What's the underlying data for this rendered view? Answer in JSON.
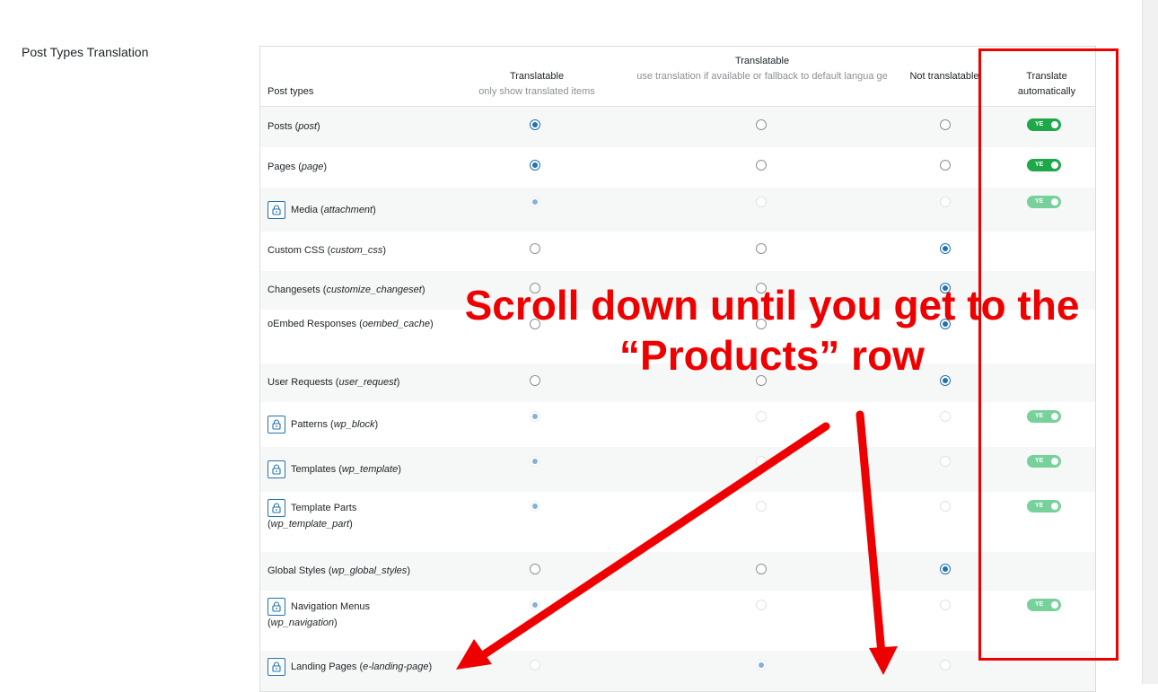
{
  "section": {
    "title": "Post Types Translation"
  },
  "header": {
    "post_types": "Post types",
    "translatable": {
      "title": "Translatable",
      "sub": "only show translated items"
    },
    "fallback": {
      "title": "Translatable",
      "sub": "use translation if available or fallback to default langua ge"
    },
    "not_translatable": "Not translatable",
    "auto": "Translate automatically"
  },
  "rows": [
    {
      "label": "Posts (",
      "slug": "post",
      "end": ")",
      "locked": false,
      "selected": "translatable",
      "auto": "YE"
    },
    {
      "label": "Pages (",
      "slug": "page",
      "end": ")",
      "locked": false,
      "selected": "translatable",
      "auto": "YE"
    },
    {
      "label": "Media (",
      "slug": "attachment",
      "end": ")",
      "locked": true,
      "selected": "translatable",
      "auto": "YE"
    },
    {
      "label": "Custom CSS (",
      "slug": "custom_css",
      "end": ")",
      "locked": false,
      "selected": "not_translatable",
      "auto": ""
    },
    {
      "label": "Changesets (",
      "slug": "customize_changeset",
      "end": ")",
      "locked": false,
      "selected": "not_translatable",
      "auto": ""
    },
    {
      "label": "oEmbed Responses (",
      "slug": "oembed_cache",
      "end": ")",
      "locked": false,
      "selected": "not_translatable",
      "auto": ""
    },
    {
      "label": "User Requests (",
      "slug": "user_request",
      "end": ")",
      "locked": false,
      "selected": "not_translatable",
      "auto": ""
    },
    {
      "label": "Patterns (",
      "slug": "wp_block",
      "end": ")",
      "locked": true,
      "selected": "translatable",
      "auto": "YE"
    },
    {
      "label": "Templates (",
      "slug": "wp_template",
      "end": ")",
      "locked": true,
      "selected": "translatable",
      "auto": "YE"
    },
    {
      "label": "Template Parts (",
      "slug": "wp_template_part",
      "end": ")",
      "locked": true,
      "selected": "translatable",
      "auto": "YE"
    },
    {
      "label": "Global Styles (",
      "slug": "wp_global_styles",
      "end": ")",
      "locked": false,
      "selected": "not_translatable",
      "auto": ""
    },
    {
      "label": "Navigation Menus (",
      "slug": "wp_navigation",
      "end": ")",
      "locked": true,
      "selected": "translatable",
      "auto": "YE"
    },
    {
      "label": "Landing Pages (",
      "slug": "e-landing-page",
      "end": ")",
      "locked": true,
      "selected": "fallback",
      "auto": ""
    }
  ],
  "annotation": {
    "line1": "Scroll down until you get to the",
    "line2": "“Products” row",
    "color": "#ee0000"
  },
  "colors": {
    "accent": "#2271b1",
    "toggle_on": "#1ea84a",
    "toggle_disabled": "#76d19a"
  }
}
